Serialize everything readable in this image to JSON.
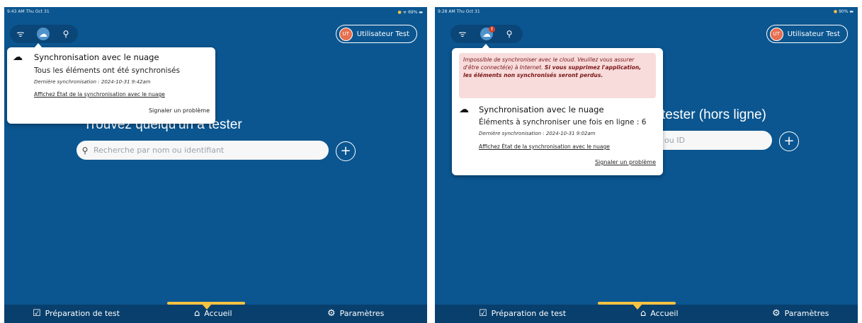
{
  "screens": [
    {
      "status": {
        "time": "9:43 AM  Thu Oct 31",
        "battery": "69%"
      },
      "user": {
        "initials": "UT",
        "name": "Utilisateur Test"
      },
      "main": {
        "title": "Trouvez quelqu'un à tester",
        "search_placeholder": "Recherche par nom ou identifiant"
      },
      "popup": {
        "title": "Synchronisation avec le nuage",
        "status": "Tous les éléments ont été synchronisés",
        "last_sync": "Dernière synchronisation : 2024-10-31 9:42am",
        "link": "Affichez État de la synchronisation avec le nuage",
        "report": "Signaler un problème"
      },
      "nav": {
        "prep": "Préparation de test",
        "home": "Accueil",
        "settings": "Paramètres"
      }
    },
    {
      "status": {
        "time": "9:28 AM  Thu Oct 31",
        "battery": "90%"
      },
      "user": {
        "initials": "UT",
        "name": "Utilisateur Test"
      },
      "main": {
        "title_visible": "tester (hors ligne)",
        "search_placeholder_visible": "ou ID"
      },
      "popup": {
        "error_italic": "Impossible de synchroniser avec le cloud. Veuillez vous assurer d'être connecté(e) à Internet. ",
        "error_bold": "Si vous supprimez l'application, les éléments non synchronisés seront perdus.",
        "title": "Synchronisation avec le nuage",
        "status": "Éléments à synchroniser une fois en ligne : 6",
        "last_sync": "Dernière synchronisation : 2024-10-31 9:02am",
        "link": "Affichez État de la synchronisation avec le nuage",
        "report": "Signaler un problème"
      },
      "nav": {
        "prep": "Préparation de test",
        "home": "Accueil",
        "settings": "Paramètres"
      }
    }
  ]
}
